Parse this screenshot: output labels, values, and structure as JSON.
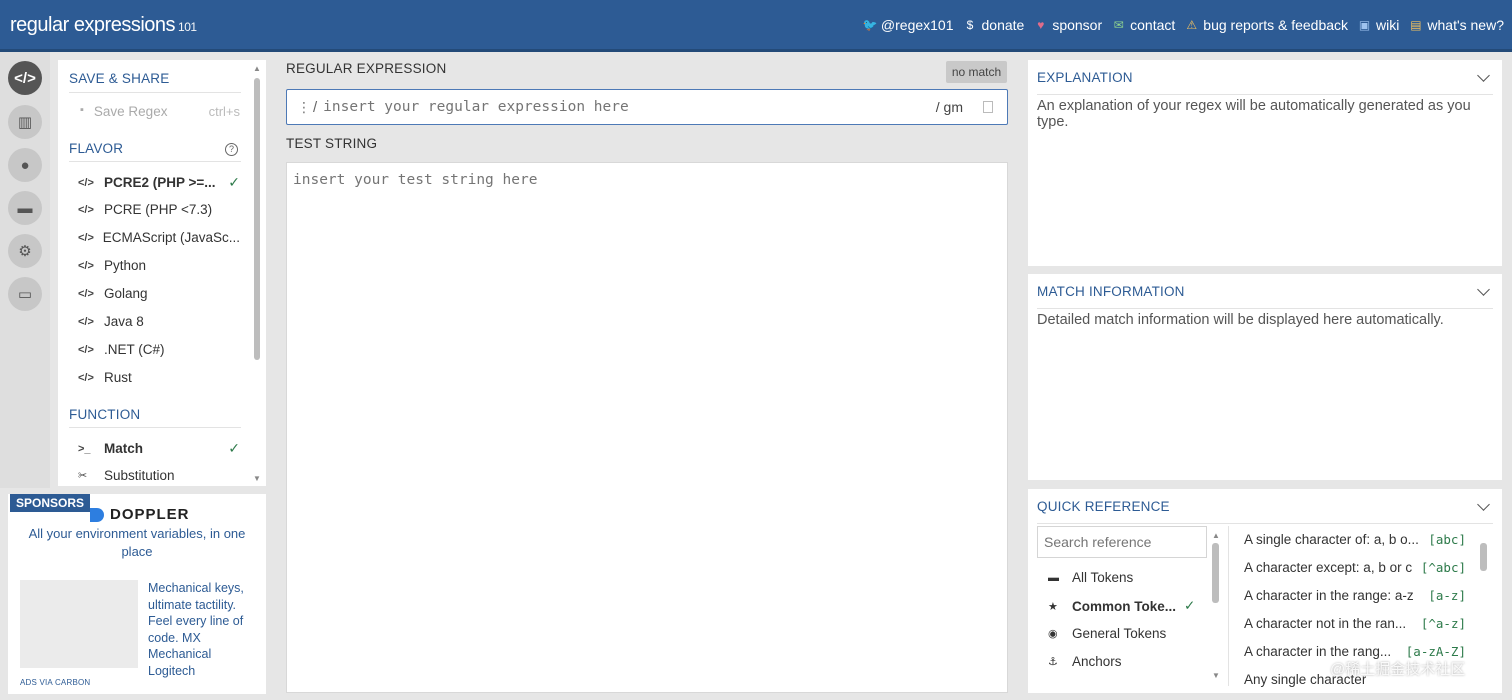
{
  "header": {
    "logo": "regular expressions",
    "logo_sub": "101",
    "nav": [
      {
        "icon": "twitter-icon",
        "glyph": "🐦",
        "label": "@regex101"
      },
      {
        "icon": "dollar-icon",
        "glyph": "$",
        "label": "donate"
      },
      {
        "icon": "heart-icon",
        "glyph": "♥",
        "label": "sponsor"
      },
      {
        "icon": "mail-icon",
        "glyph": "✉",
        "label": "contact"
      },
      {
        "icon": "warning-icon",
        "glyph": "⚠",
        "label": "bug reports & feedback"
      },
      {
        "icon": "wiki-icon",
        "glyph": "▣",
        "label": "wiki"
      },
      {
        "icon": "news-icon",
        "glyph": "▤",
        "label": "what's new?"
      }
    ]
  },
  "sidebar": {
    "save_title": "SAVE & SHARE",
    "save_label": "Save Regex",
    "save_shortcut": "ctrl+s",
    "flavor_title": "FLAVOR",
    "flavors": [
      {
        "label": "PCRE2 (PHP >=...",
        "selected": true
      },
      {
        "label": "PCRE (PHP <7.3)",
        "selected": false
      },
      {
        "label": "ECMAScript (JavaSc...",
        "selected": false
      },
      {
        "label": "Python",
        "selected": false
      },
      {
        "label": "Golang",
        "selected": false
      },
      {
        "label": "Java 8",
        "selected": false
      },
      {
        "label": ".NET (C#)",
        "selected": false
      },
      {
        "label": "Rust",
        "selected": false
      }
    ],
    "function_title": "FUNCTION",
    "functions": [
      {
        "label": "Match",
        "icon": ">_",
        "selected": true
      },
      {
        "label": "Substitution",
        "icon": "✂",
        "selected": false
      }
    ]
  },
  "sponsor": {
    "tag": "SPONSORS",
    "brand": "DOPPLER",
    "tagline": "All your environment variables, in one place",
    "ad_text": "Mechanical keys, ultimate tactility. Feel every line of code. MX Mechanical Logitech",
    "ad_via": "ADS VIA CARBON"
  },
  "editor": {
    "regex_title": "REGULAR EXPRESSION",
    "match_status": "no match",
    "regex_delim": "/",
    "regex_placeholder": "insert your regular expression here",
    "regex_flags": "/ gm",
    "test_title": "TEST STRING",
    "test_placeholder": "insert your test string here"
  },
  "explanation": {
    "title": "EXPLANATION",
    "text": "An explanation of your regex will be automatically generated as you type."
  },
  "match_info": {
    "title": "MATCH INFORMATION",
    "text": "Detailed match information will be displayed here automatically."
  },
  "quick_ref": {
    "title": "QUICK REFERENCE",
    "search_placeholder": "Search reference",
    "categories": [
      {
        "label": "All Tokens",
        "glyph": "▬"
      },
      {
        "label": "Common Toke...",
        "glyph": "★",
        "selected": true
      },
      {
        "label": "General Tokens",
        "glyph": "◉"
      },
      {
        "label": "Anchors",
        "glyph": "⚓"
      }
    ],
    "items": [
      {
        "desc": "A single character of: a, b o...",
        "token": "[abc]"
      },
      {
        "desc": "A character except: a, b or c",
        "token": "[^abc]"
      },
      {
        "desc": "A character in the range: a-z",
        "token": "[a-z]"
      },
      {
        "desc": "A character not in the ran...",
        "token": "[^a-z]"
      },
      {
        "desc": "A character in the rang...",
        "token": "[a-zA-Z]"
      },
      {
        "desc": "Any single character",
        "token": ""
      }
    ]
  },
  "watermark": "@稀土掘金技术社区"
}
